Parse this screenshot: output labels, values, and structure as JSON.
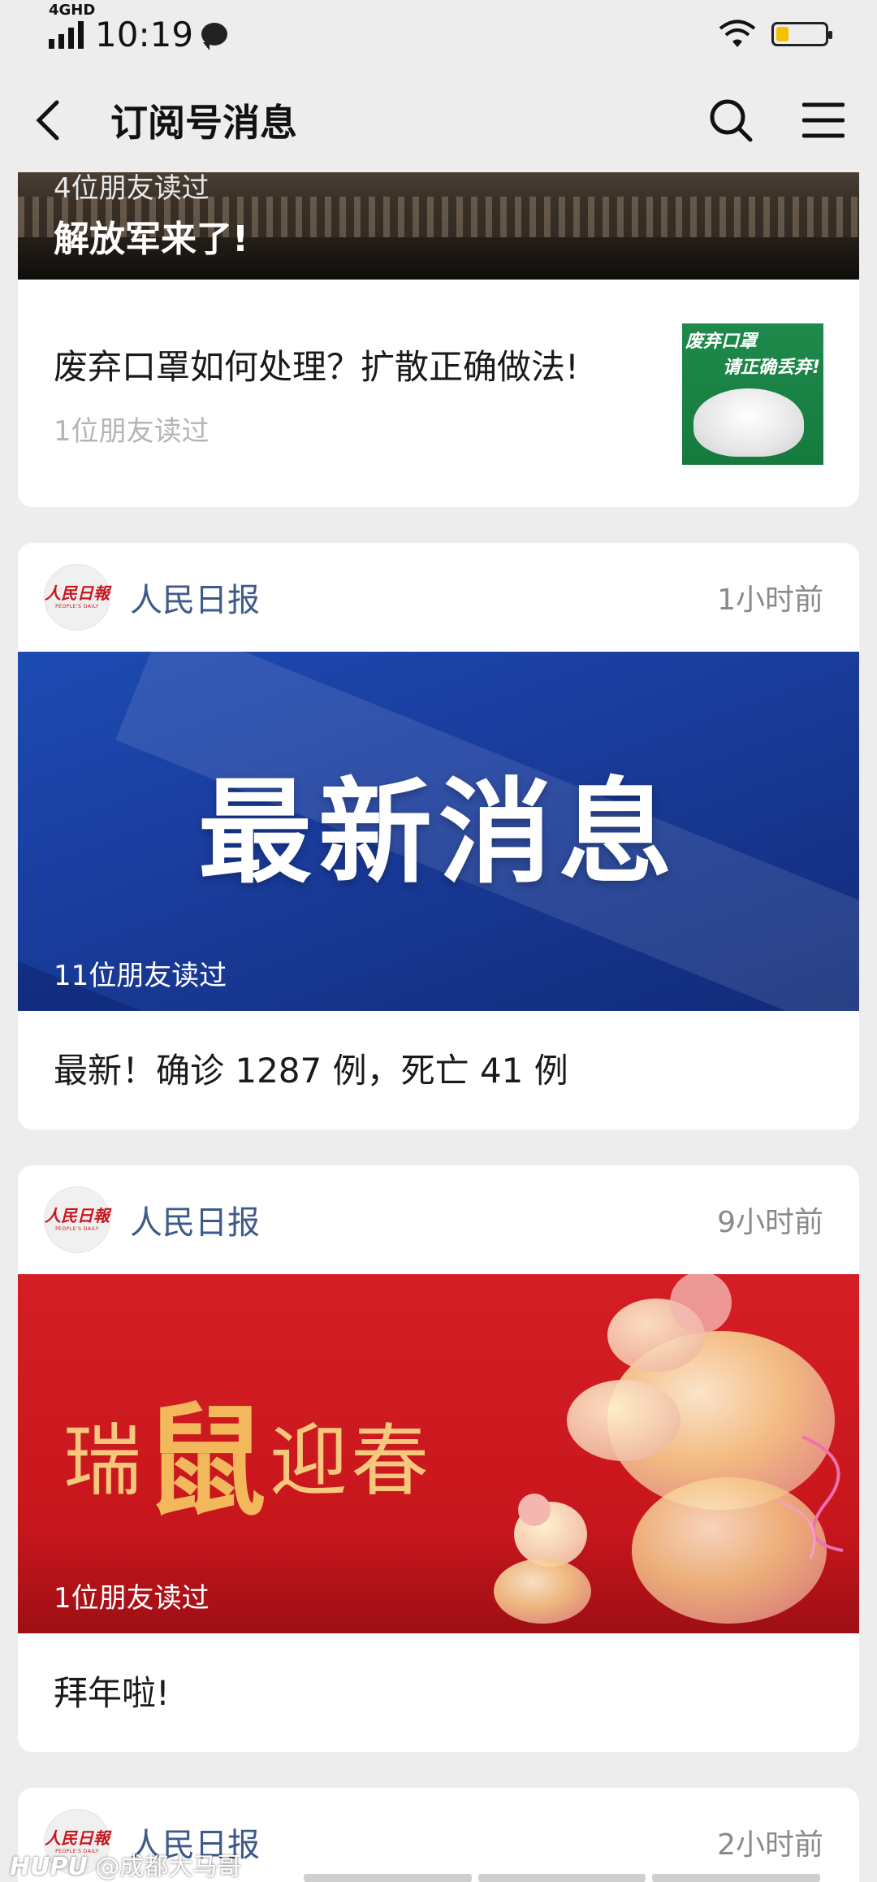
{
  "status_bar": {
    "network": "4GHD",
    "time": "10:19",
    "battery_level": 0.25,
    "battery_color": "#f5c000"
  },
  "nav": {
    "title": "订阅号消息",
    "back_icon": "chevron-left-icon",
    "search_icon": "search-icon",
    "menu_icon": "menu-icon"
  },
  "top_article": {
    "reads": "4位朋友读过",
    "headline": "解放军来了!",
    "sub_title": "废弃口罩如何处理？扩散正确做法!",
    "sub_reads": "1位朋友读过",
    "thumb_line1": "废弃口罩",
    "thumb_line2": "请正确丢弃!"
  },
  "cards": [
    {
      "publisher": "人民日报",
      "logo_cn": "人民日報",
      "logo_en": "PEOPLE'S DAILY",
      "time": "1小时前",
      "hero_text": "最新消息",
      "reads": "11位朋友读过",
      "title": "最新！确诊 1287 例，死亡 41 例"
    },
    {
      "publisher": "人民日报",
      "logo_cn": "人民日報",
      "logo_en": "PEOPLE'S DAILY",
      "time": "9小时前",
      "hero_text_a": "瑞",
      "hero_text_b": "鼠",
      "hero_text_c": "迎春",
      "reads": "1位朋友读过",
      "title": "拜年啦!"
    },
    {
      "publisher": "人民日报",
      "logo_cn": "人民日報",
      "logo_en": "PEOPLE'S DAILY",
      "time": "2小时前"
    }
  ],
  "watermark": {
    "brand": "HUPU",
    "user": "@成都大马哥"
  },
  "colors": {
    "background": "#ededed",
    "publisher_name": "#3d5a8a",
    "brand_red": "#c8161d"
  }
}
